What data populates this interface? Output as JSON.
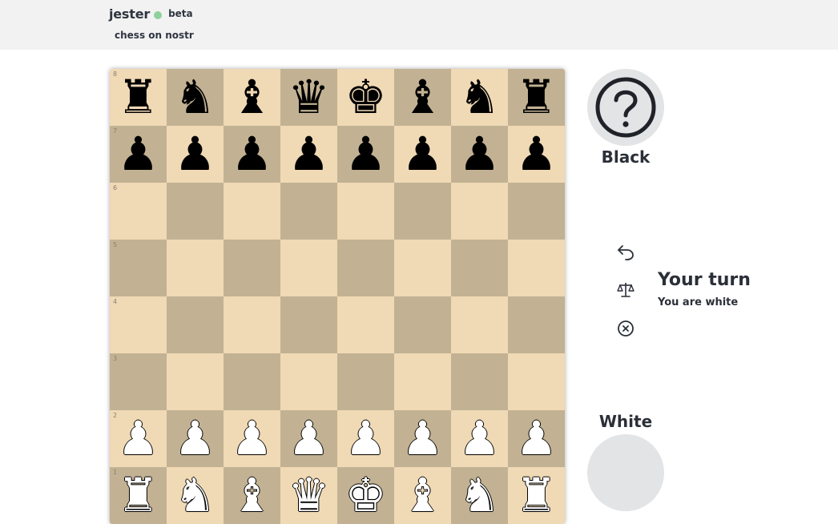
{
  "header": {
    "app_name": "jester",
    "badge": "beta",
    "tagline": "chess on nostr",
    "status_color": "#8fd19e"
  },
  "board": {
    "light_color": "#f0d9b5",
    "dark_color": "#c2b293",
    "rank_labels": [
      "8",
      "7",
      "6",
      "5",
      "4",
      "3",
      "2",
      "1"
    ],
    "position": [
      [
        "r",
        "n",
        "b",
        "q",
        "k",
        "b",
        "n",
        "r"
      ],
      [
        "p",
        "p",
        "p",
        "p",
        "p",
        "p",
        "p",
        "p"
      ],
      [
        "",
        "",
        "",
        "",
        "",
        "",
        "",
        ""
      ],
      [
        "",
        "",
        "",
        "",
        "",
        "",
        "",
        ""
      ],
      [
        "",
        "",
        "",
        "",
        "",
        "",
        "",
        ""
      ],
      [
        "",
        "",
        "",
        "",
        "",
        "",
        "",
        ""
      ],
      [
        "P",
        "P",
        "P",
        "P",
        "P",
        "P",
        "P",
        "P"
      ],
      [
        "R",
        "N",
        "B",
        "Q",
        "K",
        "B",
        "N",
        "R"
      ]
    ]
  },
  "players": {
    "black": {
      "label": "Black",
      "avatar_icon": "question-mark-icon"
    },
    "white": {
      "label": "White",
      "avatar_icon": "blank-avatar"
    }
  },
  "actions": [
    {
      "name": "undo",
      "icon": "undo-arrow-icon"
    },
    {
      "name": "offer-draw",
      "icon": "scales-icon"
    },
    {
      "name": "resign",
      "icon": "close-circle-icon"
    }
  ],
  "status": {
    "title": "Your turn",
    "subtitle": "You are white"
  }
}
